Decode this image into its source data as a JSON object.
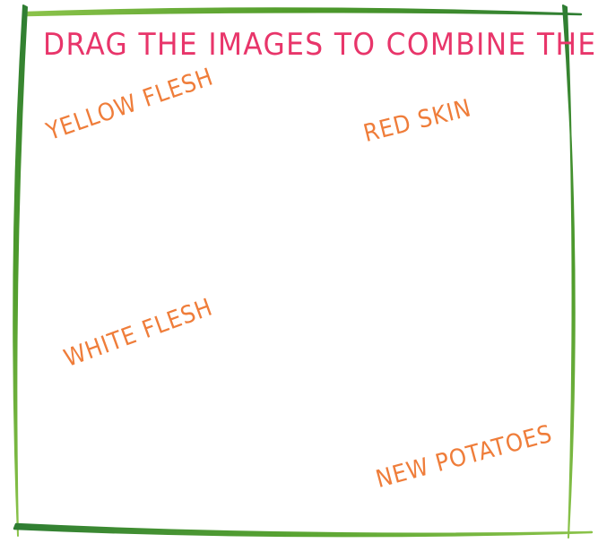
{
  "title": "DRAG THE IMAGES TO COMBINE THEM",
  "items": [
    {
      "label": "YELLOW FLESH"
    },
    {
      "label": "RED SKIN"
    },
    {
      "label": "WHITE FLESH"
    },
    {
      "label": "NEW POTATOES"
    }
  ],
  "colors": {
    "title": "#e8356a",
    "label": "#ef7d3a",
    "frame_dark": "#2e7d32",
    "frame_light": "#8bc34a"
  }
}
